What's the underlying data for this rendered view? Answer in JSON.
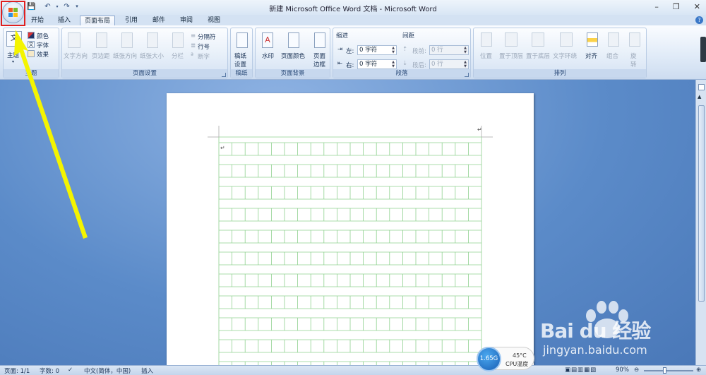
{
  "window": {
    "title": "新建 Microsoft Office Word 文档 - Microsoft Word",
    "minimize": "–",
    "restore": "❐",
    "close": "✕"
  },
  "qat": {
    "save": "💾",
    "undo": "↶",
    "redo": "↷",
    "more": "▾"
  },
  "tabs": [
    "开始",
    "插入",
    "页面布局",
    "引用",
    "邮件",
    "审阅",
    "视图"
  ],
  "active_tab": "页面布局",
  "help_label": "?",
  "ribbon": {
    "theme_group": {
      "label": "主题",
      "theme_btn": "主题",
      "colors": "颜色",
      "fonts": "字体",
      "effects": "效果"
    },
    "page_setup_group": {
      "label": "页面设置",
      "text_direction": "文字方向",
      "margins": "页边距",
      "orientation": "纸张方向",
      "size": "纸张大小",
      "columns": "分栏",
      "breaks": "分隔符",
      "line_numbers": "行号",
      "hyphenation": "断字"
    },
    "draft_group": {
      "label": "稿纸",
      "draft_btn_line1": "稿纸",
      "draft_btn_line2": "设置"
    },
    "background_group": {
      "label": "页面背景",
      "watermark": "水印",
      "page_color": "页面颜色",
      "page_border_line1": "页面",
      "page_border_line2": "边框"
    },
    "paragraph_group": {
      "label": "段落",
      "indent_header": "缩进",
      "spacing_header": "间距",
      "left_label": "左:",
      "right_label": "右:",
      "left_value": "0 字符",
      "right_value": "0 字符",
      "before_label": "段前:",
      "after_label": "段后:",
      "before_value": "0 行",
      "after_value": "0 行"
    },
    "arrange_group": {
      "label": "排列",
      "position": "位置",
      "bring_front": "置于顶层",
      "send_back": "置于底层",
      "wrap_text": "文字环绕",
      "align": "对齐",
      "group": "组合",
      "rotate_line1": "旋",
      "rotate_line2": "转"
    }
  },
  "document": {
    "paragraph_mark": "↵"
  },
  "status": {
    "page": "页面: 1/1",
    "words": "字数: 0",
    "language": "中文(简体，中国)",
    "mode": "插入",
    "zoom": "90%"
  },
  "widget": {
    "memory": "1.65G",
    "temp": "45°C",
    "temp_label": "CPU温度"
  },
  "watermark": {
    "brand": "Bai du 经验",
    "url": "jingyan.baidu.com"
  },
  "colors": {
    "grid": "#8fd18f",
    "arrow": "#f4f400",
    "highlight": "#e02020"
  }
}
